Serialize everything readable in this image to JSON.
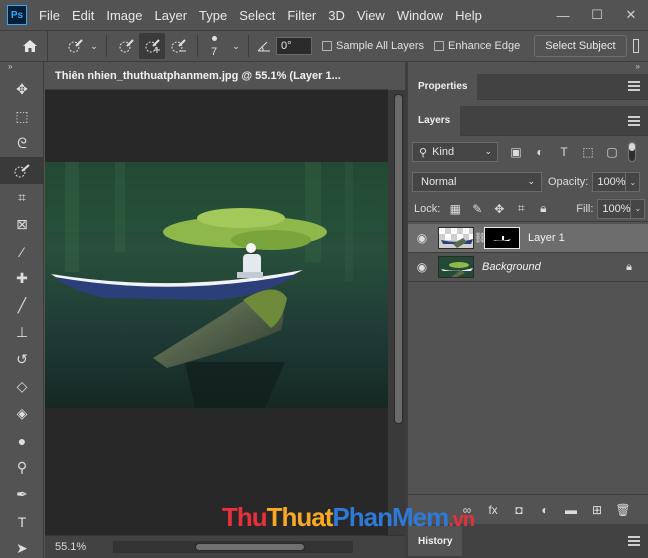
{
  "app": {
    "logo": "Ps",
    "menu": [
      "File",
      "Edit",
      "Image",
      "Layer",
      "Type",
      "Select",
      "Filter",
      "3D",
      "View",
      "Window",
      "Help"
    ],
    "window_controls": [
      "—",
      "☐",
      "✕"
    ]
  },
  "options": {
    "brush_size": "7",
    "angle": "0°",
    "sample_all_layers": "Sample All Layers",
    "enhance_edge": "Enhance Edge",
    "select_subject": "Select Subject"
  },
  "tools": [
    {
      "name": "move-tool",
      "glyph": "✥"
    },
    {
      "name": "marquee-tool",
      "glyph": "⬚"
    },
    {
      "name": "lasso-tool",
      "glyph": "ᘓ"
    },
    {
      "name": "quick-selection-tool",
      "glyph": "◌"
    },
    {
      "name": "crop-tool",
      "glyph": "⌗"
    },
    {
      "name": "frame-tool",
      "glyph": "⊠"
    },
    {
      "name": "eyedropper-tool",
      "glyph": "⁄"
    },
    {
      "name": "healing-brush-tool",
      "glyph": "✚"
    },
    {
      "name": "brush-tool",
      "glyph": "╱"
    },
    {
      "name": "clone-stamp-tool",
      "glyph": "⊥"
    },
    {
      "name": "history-brush-tool",
      "glyph": "↺"
    },
    {
      "name": "eraser-tool",
      "glyph": "◇"
    },
    {
      "name": "paint-bucket-tool",
      "glyph": "◈"
    },
    {
      "name": "blur-tool",
      "glyph": "●"
    },
    {
      "name": "dodge-tool",
      "glyph": "⚲"
    },
    {
      "name": "pen-tool",
      "glyph": "✒"
    },
    {
      "name": "type-tool",
      "glyph": "T"
    },
    {
      "name": "path-selection-tool",
      "glyph": "➤"
    }
  ],
  "document": {
    "tab_title": "Thiên nhien_thuthuatphanmem.jpg @ 55.1% (Layer 1...",
    "zoom": "55.1%"
  },
  "panels": {
    "properties_tab": "Properties",
    "layers_tab": "Layers",
    "history_tab": "History",
    "kind_label": "Kind",
    "blend_mode": "Normal",
    "opacity_label": "Opacity:",
    "opacity_value": "100%",
    "lock_label": "Lock:",
    "fill_label": "Fill:",
    "fill_value": "100%",
    "layers": [
      {
        "name": "Layer 1",
        "selected": true,
        "has_mask": true
      },
      {
        "name": "Background",
        "selected": false,
        "locked": true
      }
    ]
  },
  "watermark": {
    "part1": "Thu",
    "part2": "Thuat",
    "part3": "PhanMem",
    "part4": ".vn"
  }
}
